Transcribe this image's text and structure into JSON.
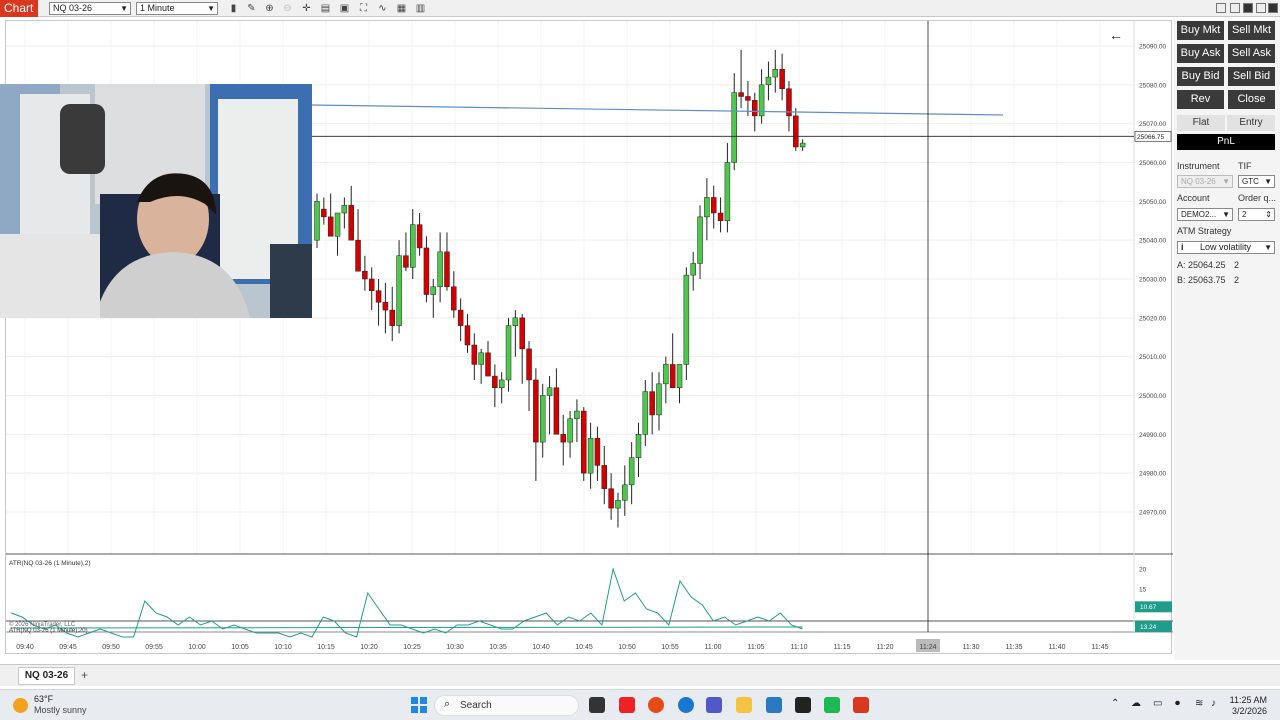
{
  "toolbar": {
    "chart_tab_label": "Chart",
    "instrument_value": "NQ 03-26",
    "interval_value": "1 Minute"
  },
  "chart": {
    "price_labels": [
      "25090.00",
      "25080.00",
      "25070.00",
      "25060.00",
      "25050.00",
      "25040.00",
      "25030.00",
      "25020.00",
      "25010.00",
      "25000.00",
      "24990.00",
      "24980.00",
      "24970.00"
    ],
    "last_price_label": "25066.75",
    "time_labels": [
      "09:40",
      "09:45",
      "09:50",
      "09:55",
      "10:00",
      "10:05",
      "10:10",
      "10:15",
      "10:20",
      "10:25",
      "10:30",
      "10:35",
      "10:40",
      "10:45",
      "10:50",
      "10:55",
      "11:00",
      "11:05",
      "11:10",
      "11:15",
      "11:20",
      "11:24",
      "11:30",
      "11:35",
      "11:40",
      "11:45"
    ],
    "highlighted_time": "11:24",
    "indicator_label": "ATR(NQ 03-26 (1 Minute),2)",
    "indicator_ticks": [
      "20",
      "15"
    ],
    "indicator_value": "10.67",
    "lower_indicator_label": "ATR(NQ 03-26 (1 Minute),20)",
    "lower_indicator_value": "13.24",
    "copyright": "© 2026 NinjaTrader, LLC",
    "colors": {
      "up": "#4cc94c",
      "down": "#d40000",
      "atr": "#1e9e8a",
      "hline": "#5b8fc7"
    }
  },
  "chart_data": {
    "type": "candlestick",
    "x_axis": "time (1 minute)",
    "y_axis": "price",
    "ylim": [
      24966,
      25093
    ],
    "candles_ohlc": [
      [
        25040,
        25052,
        25038,
        25050
      ],
      [
        25048,
        25051,
        25044,
        25046
      ],
      [
        25046,
        25052,
        25044,
        25041
      ],
      [
        25041,
        25046,
        25036,
        25047
      ],
      [
        25047,
        25051,
        25043,
        25049
      ],
      [
        25049,
        25054,
        25046,
        25040
      ],
      [
        25040,
        25048,
        25032,
        25032
      ],
      [
        25032,
        25036,
        25027,
        25030
      ],
      [
        25030,
        25033,
        25022,
        25027
      ],
      [
        25027,
        25030,
        25018,
        25024
      ],
      [
        25024,
        25029,
        25016,
        25022
      ],
      [
        25022,
        25028,
        25014,
        25018
      ],
      [
        25018,
        25040,
        25016,
        25036
      ],
      [
        25036,
        25042,
        25032,
        25033
      ],
      [
        25033,
        25048,
        25030,
        25044
      ],
      [
        25044,
        25047,
        25036,
        25038
      ],
      [
        25038,
        25041,
        25024,
        25026
      ],
      [
        25026,
        25030,
        25020,
        25028
      ],
      [
        25028,
        25042,
        25024,
        25037
      ],
      [
        25037,
        25042,
        25027,
        25028
      ],
      [
        25028,
        25032,
        25020,
        25022
      ],
      [
        25022,
        25025,
        25014,
        25018
      ],
      [
        25018,
        25021,
        25011,
        25013
      ],
      [
        25013,
        25016,
        25004,
        25008
      ],
      [
        25008,
        25012,
        25003,
        25011
      ],
      [
        25011,
        25014,
        25005,
        25005
      ],
      [
        25005,
        25008,
        24997,
        25002
      ],
      [
        25002,
        25006,
        24998,
        25004
      ],
      [
        25004,
        25020,
        25001,
        25018
      ],
      [
        25018,
        25022,
        25010,
        25020
      ],
      [
        25020,
        25021,
        25003,
        25012
      ],
      [
        25012,
        25014,
        24996,
        25004
      ],
      [
        25004,
        25007,
        24978,
        24988
      ],
      [
        24988,
        25003,
        24984,
        25000
      ],
      [
        25000,
        25005,
        24990,
        25002
      ],
      [
        25002,
        25007,
        24994,
        24990
      ],
      [
        24990,
        24995,
        24982,
        24988
      ],
      [
        24988,
        24996,
        24984,
        24994
      ],
      [
        24994,
        24999,
        24988,
        24996
      ],
      [
        24996,
        24997,
        24978,
        24980
      ],
      [
        24980,
        24993,
        24976,
        24989
      ],
      [
        24989,
        24992,
        24978,
        24982
      ],
      [
        24982,
        24987,
        24972,
        24976
      ],
      [
        24976,
        24980,
        24968,
        24971
      ],
      [
        24971,
        24975,
        24966,
        24973
      ],
      [
        24973,
        24982,
        24969,
        24977
      ],
      [
        24977,
        24988,
        24972,
        24984
      ],
      [
        24984,
        24993,
        24979,
        24990
      ],
      [
        24990,
        25004,
        24987,
        25001
      ],
      [
        25001,
        25006,
        24990,
        24995
      ],
      [
        24995,
        25006,
        24991,
        25003
      ],
      [
        25003,
        25010,
        24998,
        25008
      ],
      [
        25008,
        25016,
        25005,
        25002
      ],
      [
        25002,
        25008,
        24998,
        25008
      ],
      [
        25008,
        25033,
        25004,
        25031
      ],
      [
        25031,
        25037,
        25027,
        25034
      ],
      [
        25034,
        25049,
        25030,
        25046
      ],
      [
        25046,
        25056,
        25040,
        25051
      ],
      [
        25051,
        25054,
        25043,
        25047
      ],
      [
        25047,
        25051,
        25042,
        25045
      ],
      [
        25045,
        25065,
        25042,
        25060
      ],
      [
        25060,
        25083,
        25058,
        25078
      ],
      [
        25078,
        25089,
        25074,
        25077
      ],
      [
        25077,
        25081,
        25072,
        25076
      ],
      [
        25076,
        25078,
        25068,
        25072
      ],
      [
        25072,
        25084,
        25070,
        25080
      ],
      [
        25080,
        25086,
        25076,
        25082
      ],
      [
        25082,
        25089,
        25078,
        25084
      ],
      [
        25084,
        25088,
        25076,
        25079
      ],
      [
        25079,
        25081,
        25068,
        25072
      ],
      [
        25072,
        25074,
        25063,
        25064
      ],
      [
        25064,
        25066,
        25063,
        25065
      ]
    ],
    "atr2": [
      9,
      8,
      6,
      5,
      6,
      4,
      3,
      4,
      5,
      4,
      3,
      3,
      12,
      9,
      8,
      6,
      8,
      6,
      7,
      5,
      6,
      5,
      4,
      4,
      4,
      3,
      4,
      3,
      8,
      7,
      4,
      3,
      14,
      10,
      6,
      6,
      5,
      4,
      5,
      4,
      6,
      6,
      7,
      6,
      5,
      5,
      7,
      8,
      9,
      6,
      8,
      7,
      9,
      6,
      20,
      12,
      14,
      10,
      9,
      6,
      17,
      13,
      11,
      7,
      8,
      6,
      7,
      8,
      7,
      9,
      6,
      5
    ],
    "atr20_approx": 13.24
  },
  "panel": {
    "buttons": [
      [
        "Buy Mkt",
        "Sell Mkt"
      ],
      [
        "Buy Ask",
        "Sell Ask"
      ],
      [
        "Buy Bid",
        "Sell Bid"
      ],
      [
        "Rev",
        "Close"
      ]
    ],
    "tabs": [
      "Flat",
      "Entry"
    ],
    "pnl_label": "PnL",
    "instrument_label": "Instrument",
    "tif_label": "TIF",
    "instrument_value": "NQ 03-26",
    "tif_value": "GTC",
    "account_label": "Account",
    "order_qty_label": "Order q...",
    "account_value": "DEMO2...",
    "order_qty_value": "2",
    "atm_label": "ATM Strategy",
    "atm_value": "Low volatility",
    "ask_label": "A:",
    "ask_price": "25064.25",
    "ask_size": "2",
    "bid_label": "B:",
    "bid_price": "25063.75",
    "bid_size": "2"
  },
  "bottom_tab": {
    "label": "NQ 03-26",
    "add": "+"
  },
  "taskbar": {
    "temp": "63°F",
    "weather": "Mostly sunny",
    "search_placeholder": "Search",
    "time": "11:25 AM",
    "date": "3/2/2026"
  }
}
